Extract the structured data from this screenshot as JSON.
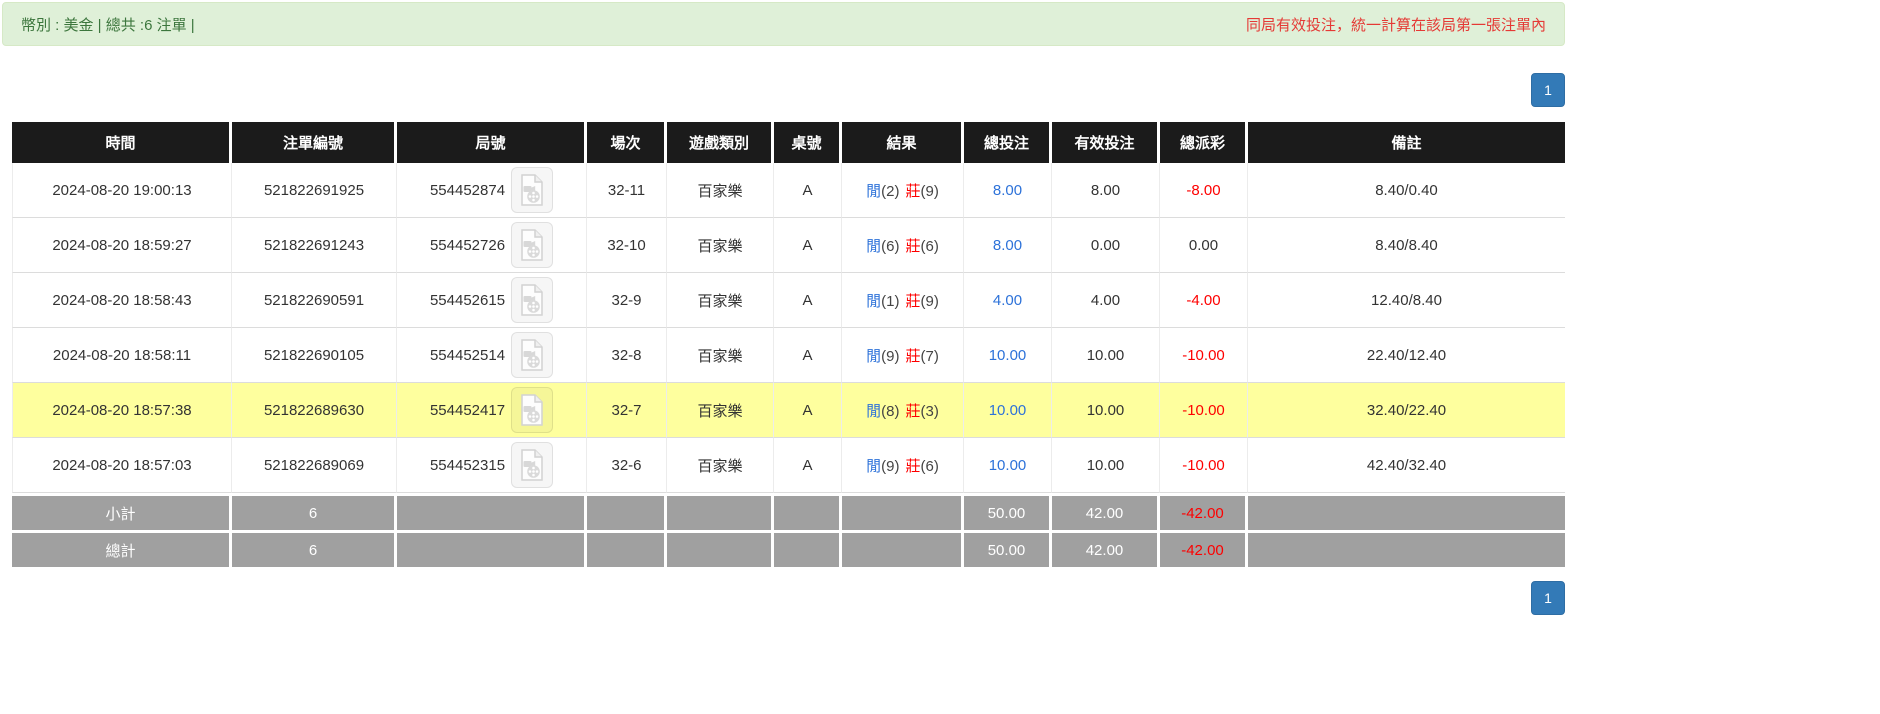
{
  "notice_bar": {
    "left_text": "幣別 : 美金 | 總共 :6 注單 |",
    "right_text": "同局有效投注，統一計算在該局第一張注單內"
  },
  "pagination": {
    "page": "1"
  },
  "colors": {
    "accent_blue": "#2d72d9",
    "negative_red": "#fe0000",
    "notice_bg_green": "#dff0d8",
    "notice_text_green": "#3c763d",
    "notice_text_red": "#e53935",
    "header_bg": "#1b1b1b",
    "footer_bg": "#a0a0a0",
    "highlight_yellow": "#feff9e",
    "pager_blue": "#337ab7"
  },
  "table": {
    "headers": [
      "時間",
      "注單編號",
      "局號",
      "場次",
      "遊戲類別",
      "桌號",
      "結果",
      "總投注",
      "有效投注",
      "總派彩",
      "備註"
    ],
    "rows": [
      {
        "time": "2024-08-20 19:00:13",
        "bet_id": "521822691925",
        "round_id": "554452874",
        "session": "32-11",
        "game": "百家樂",
        "table_no": "A",
        "player_label": "閒",
        "player_score": "(2)",
        "banker_label": "莊",
        "banker_score": "(9)",
        "total_bet": "8.00",
        "valid_bet": "8.00",
        "payout": "-8.00",
        "remark": "8.40/0.40"
      },
      {
        "time": "2024-08-20 18:59:27",
        "bet_id": "521822691243",
        "round_id": "554452726",
        "session": "32-10",
        "game": "百家樂",
        "table_no": "A",
        "player_label": "閒",
        "player_score": "(6)",
        "banker_label": "莊",
        "banker_score": "(6)",
        "total_bet": "8.00",
        "valid_bet": "0.00",
        "payout": "0.00",
        "remark": "8.40/8.40"
      },
      {
        "time": "2024-08-20 18:58:43",
        "bet_id": "521822690591",
        "round_id": "554452615",
        "session": "32-9",
        "game": "百家樂",
        "table_no": "A",
        "player_label": "閒",
        "player_score": "(1)",
        "banker_label": "莊",
        "banker_score": "(9)",
        "total_bet": "4.00",
        "valid_bet": "4.00",
        "payout": "-4.00",
        "remark": "12.40/8.40"
      },
      {
        "time": "2024-08-20 18:58:11",
        "bet_id": "521822690105",
        "round_id": "554452514",
        "session": "32-8",
        "game": "百家樂",
        "table_no": "A",
        "player_label": "閒",
        "player_score": "(9)",
        "banker_label": "莊",
        "banker_score": "(7)",
        "total_bet": "10.00",
        "valid_bet": "10.00",
        "payout": "-10.00",
        "remark": "22.40/12.40"
      },
      {
        "time": "2024-08-20 18:57:38",
        "bet_id": "521822689630",
        "round_id": "554452417",
        "session": "32-7",
        "game": "百家樂",
        "table_no": "A",
        "player_label": "閒",
        "player_score": "(8)",
        "banker_label": "莊",
        "banker_score": "(3)",
        "total_bet": "10.00",
        "valid_bet": "10.00",
        "payout": "-10.00",
        "remark": "32.40/22.40"
      },
      {
        "time": "2024-08-20 18:57:03",
        "bet_id": "521822689069",
        "round_id": "554452315",
        "session": "32-6",
        "game": "百家樂",
        "table_no": "A",
        "player_label": "閒",
        "player_score": "(9)",
        "banker_label": "莊",
        "banker_score": "(6)",
        "total_bet": "10.00",
        "valid_bet": "10.00",
        "payout": "-10.00",
        "remark": "42.40/32.40"
      }
    ],
    "footer": [
      {
        "label": "小計",
        "count": "6",
        "total_bet": "50.00",
        "valid_bet": "42.00",
        "payout": "-42.00"
      },
      {
        "label": "總計",
        "count": "6",
        "total_bet": "50.00",
        "valid_bet": "42.00",
        "payout": "-42.00"
      }
    ]
  }
}
